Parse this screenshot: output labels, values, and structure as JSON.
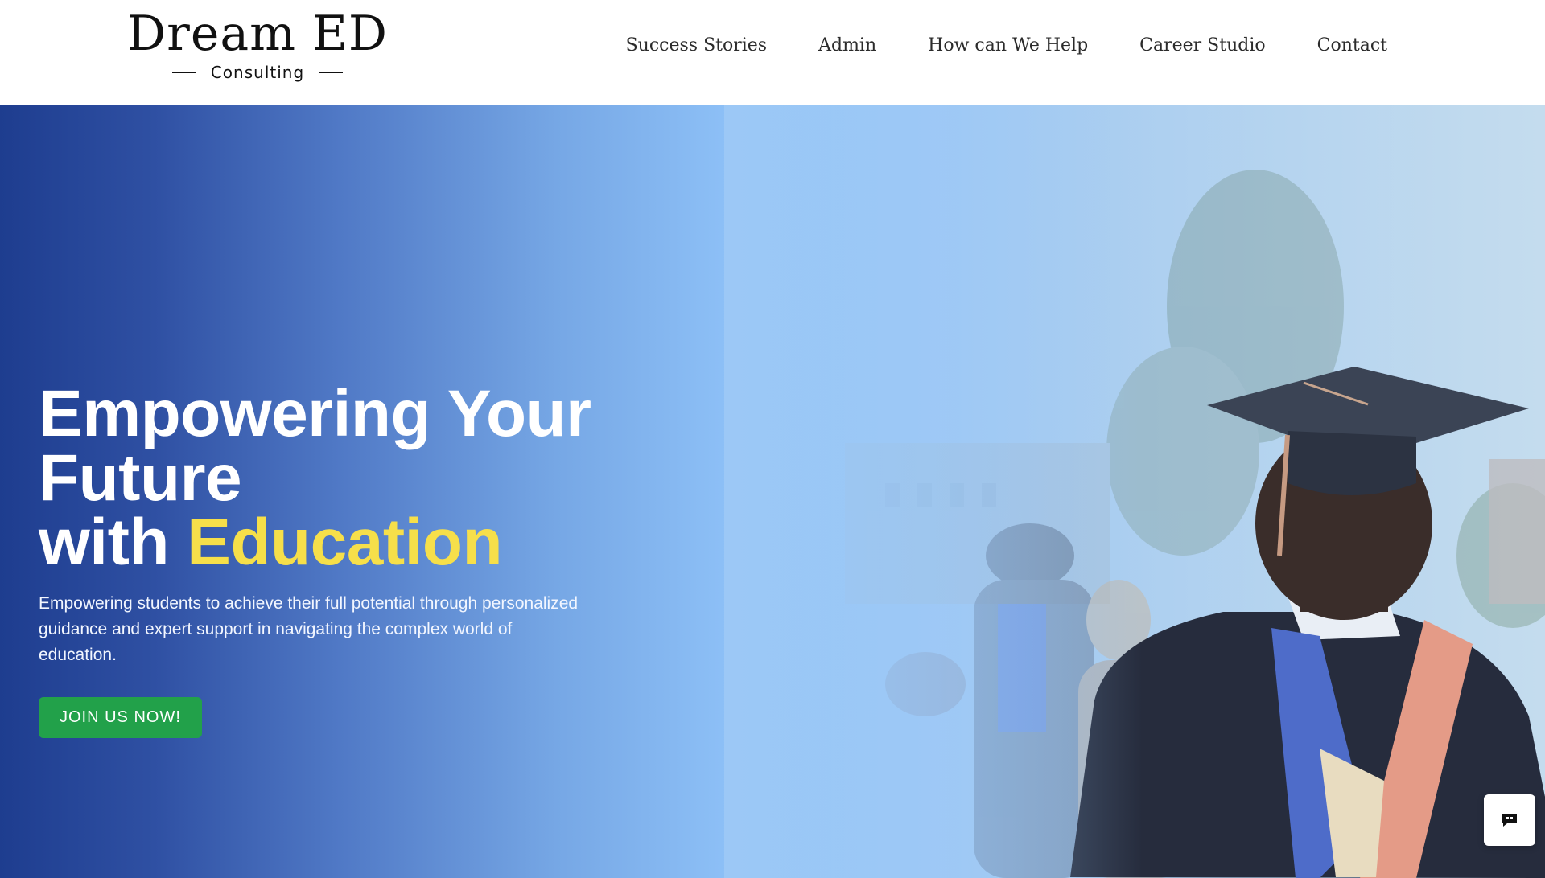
{
  "logo": {
    "main": "Dream ED",
    "sub": "Consulting"
  },
  "nav": {
    "items": [
      {
        "label": "Success Stories"
      },
      {
        "label": "Admin"
      },
      {
        "label": "How can We Help"
      },
      {
        "label": "Career Studio"
      },
      {
        "label": "Contact"
      }
    ]
  },
  "hero": {
    "title_line1": "Empowering Your",
    "title_line2": "Future",
    "title_line3_prefix": "with ",
    "title_accent": "Education",
    "description": "Empowering students to achieve their full potential through personalized guidance and expert support in navigating the complex world of education.",
    "cta_label": "JOIN US NOW!"
  },
  "colors": {
    "accent_yellow": "#f6df4a",
    "cta_green": "#22a14a",
    "hero_blue_dark": "#1e3d8f",
    "hero_blue_light": "#9cc8f6"
  },
  "icons": {
    "chat": "chat-bubble-quote-icon",
    "hero_image": "graduation-student-image"
  }
}
